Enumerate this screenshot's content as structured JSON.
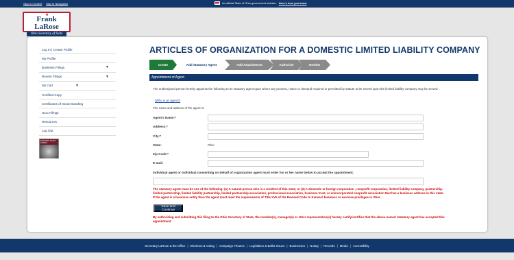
{
  "topbar": {
    "skip_content": "Skip to Content",
    "skip_navigation": "Skip to Navigation",
    "official_notice": "An official State of Ohio government website.",
    "how_you_know": "Here's how you know"
  },
  "logo": {
    "name": "Frank LaRose",
    "office": "Ohio Secretary of State"
  },
  "sidebar": {
    "items": [
      {
        "label": "Log In | Create Profile",
        "chevron": false
      },
      {
        "label": "My Profile",
        "chevron": false
      },
      {
        "label": "Business Filings",
        "chevron": true
      },
      {
        "label": "Recent Filings",
        "chevron": true
      },
      {
        "label": "My Cart",
        "chevron": true
      },
      {
        "label": "Certified Copy",
        "chevron": false
      },
      {
        "label": "Certificates of Good Standing",
        "chevron": false
      },
      {
        "label": "UCC Filings",
        "chevron": false
      },
      {
        "label": "Resources",
        "chevron": false
      },
      {
        "label": "Log Out",
        "chevron": false
      }
    ],
    "badge_text": "BUSINESS FILING PORTAL"
  },
  "page": {
    "title": "ARTICLES OF ORGANIZATION FOR A DOMESTIC LIMITED LIABILITY COMPANY"
  },
  "steps": [
    "Create",
    "Add Statutory Agent",
    "Add Attachments",
    "Authorize",
    "Review"
  ],
  "form": {
    "section_title": "Appointment of Agent",
    "intro": "The undersigned person hereby appoints the following to be statutory agent upon whom any process, notice or demand required or permitted by statute to be served upon the limited liability company may be served.",
    "what_is_agent": "(Who is an agent?)",
    "address_intro": "The name and address of the agent is:",
    "agent_name_label": "Agent's Name:*",
    "address_label": "Address:*",
    "city_label": "City:*",
    "state_label": "State:",
    "state_value": "Ohio",
    "zip_label": "Zip Code:*",
    "email_label": "E-mail:",
    "consent_label": "Individual agent or individual consenting on behalf of organization agent must enter his or her name below to accept the appointment.",
    "warning_1": "The statutory agent must be one of the following: (1) A natural person who is a resident of this state; or (2) A domestic or foreign corporation , nonprofit corporation, limited liability company, partnership, limited partnership, limited liability partnership, limited partnership association, professional association, business trust, or unincorporated nonprofit association that has a business address in this state. If the agent is a business entity then the agent must meet the requirements of Title XVII of the Revised Code to transact business or exercise privileges in Ohio.",
    "save_button": "Save and Continue",
    "warning_2": "By authorizing and submitting this filing to the Ohio Secretary of State, the member(s), manager(s) or other representative(s) hereby certify/certifies that the above-named statutory agent has accepted this appointment."
  },
  "footer": {
    "links": [
      "Secretary LaRose & the Office",
      "Elections & Voting",
      "Campaign Finance",
      "Legislation & Ballot Issues",
      "Businesses",
      "Notary",
      "Records",
      "Media",
      "Accessibility"
    ]
  },
  "colors": {
    "brand_navy": "#12386b",
    "step_active": "#1f7a3a",
    "warning_red": "#cc0000"
  }
}
